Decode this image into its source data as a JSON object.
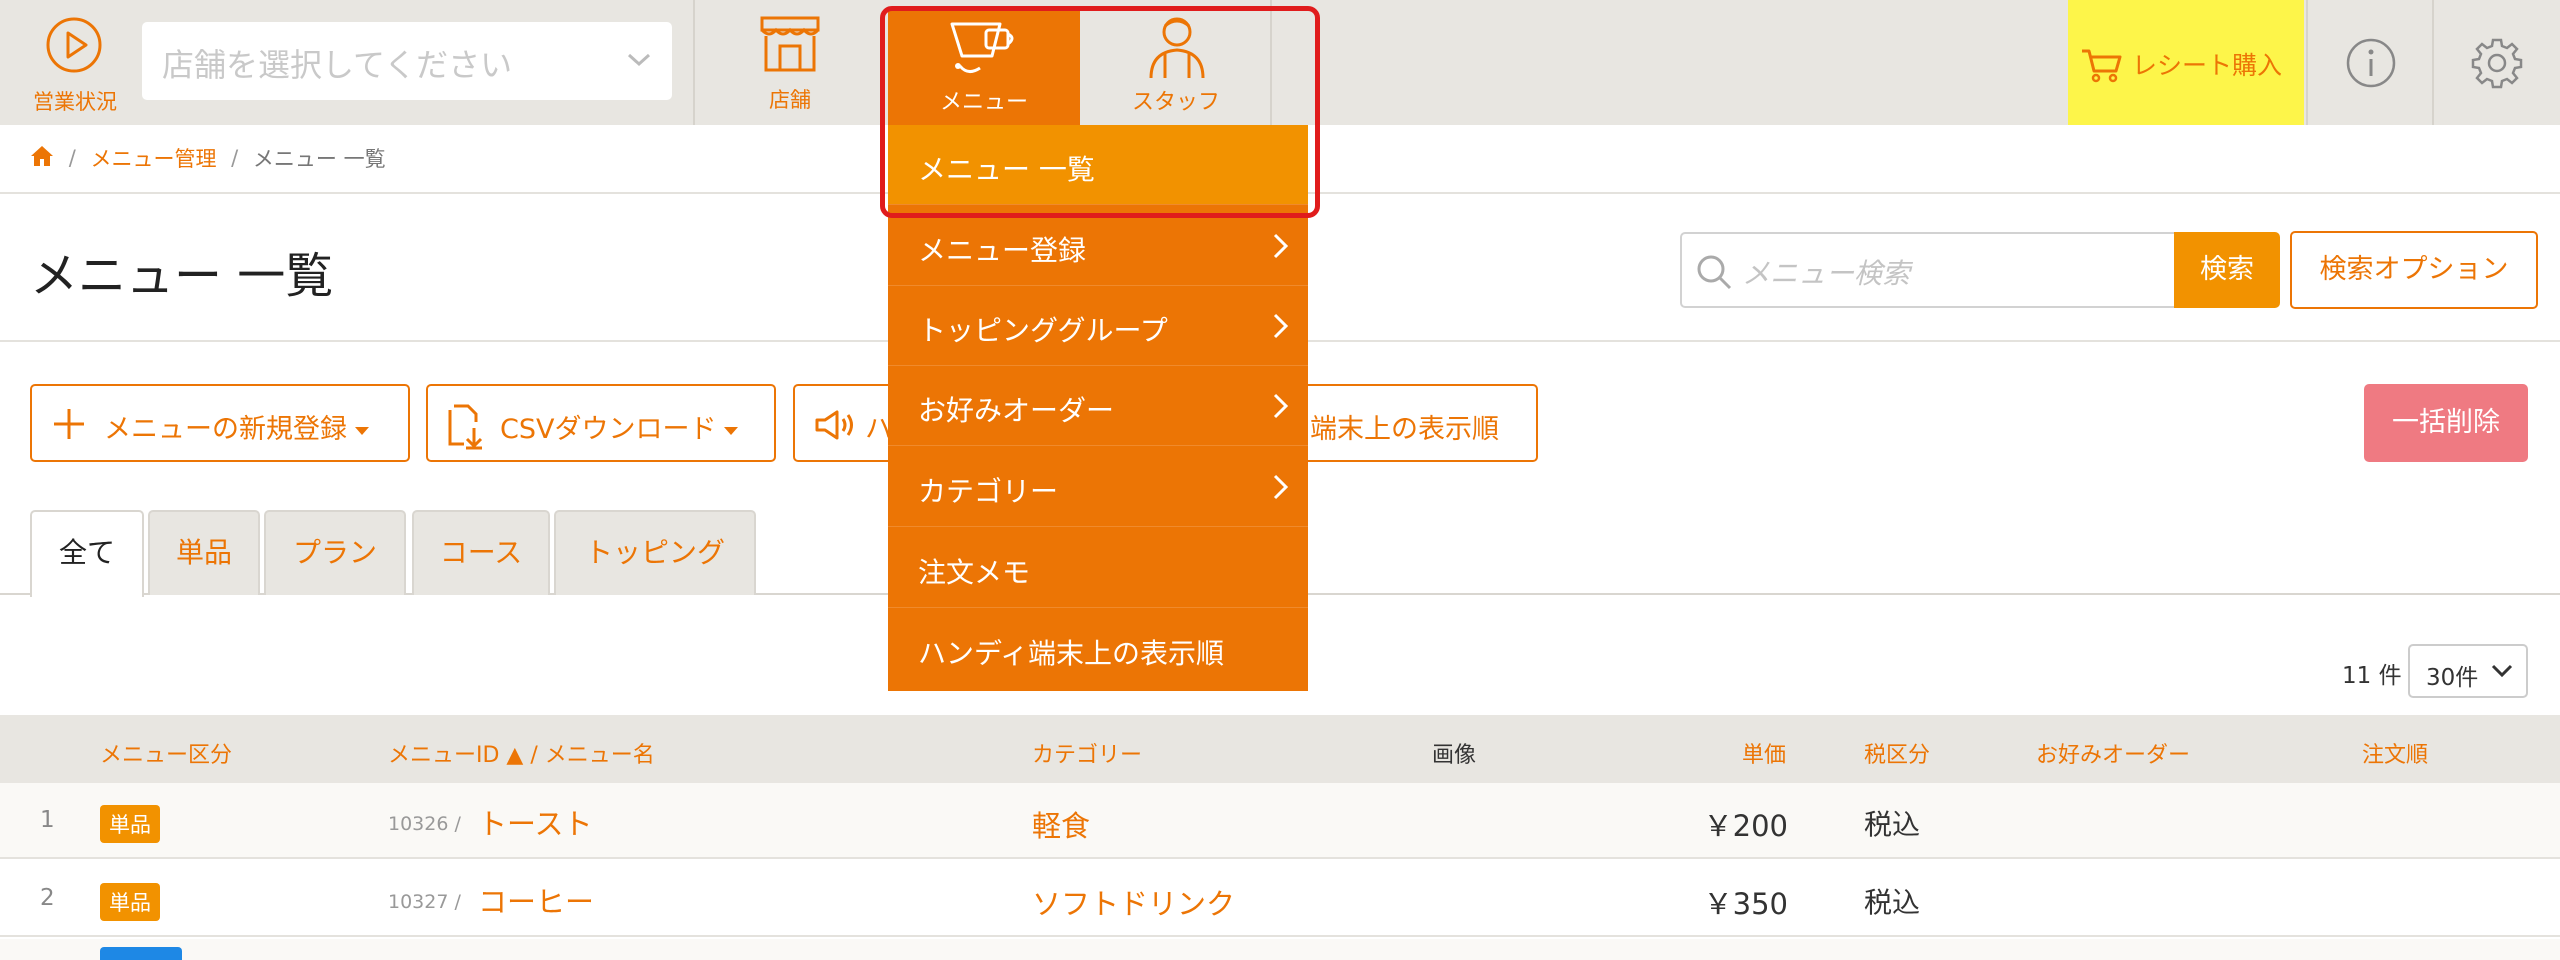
{
  "nav": {
    "status_label": "営業状況",
    "store_select_placeholder": "店舗を選択してください",
    "store_label": "店舗",
    "menu_label": "メニュー",
    "staff_label": "スタッフ",
    "receipt_label": "レシート購入"
  },
  "breadcrumb": {
    "items": [
      "メニュー管理",
      "メニュー 一覧"
    ]
  },
  "page": {
    "title": "メニュー 一覧"
  },
  "search": {
    "placeholder": "メニュー検索",
    "button": "検索",
    "options": "検索オプション"
  },
  "actions": {
    "new_menu": "メニューの新規登録",
    "csv": "CSVダウンロード",
    "handy_partial": "ハ",
    "display_order_partial": "端末上の表示順",
    "bulk_delete": "一括削除"
  },
  "tabs": [
    "全て",
    "単品",
    "プラン",
    "コース",
    "トッピング"
  ],
  "table": {
    "count": "11 件",
    "per_page": "30件",
    "headers": {
      "type": "メニュー区分",
      "id_name": "メニューID ▲ / メニュー名",
      "category": "カテゴリー",
      "image": "画像",
      "price": "単価",
      "tax": "税区分",
      "preference": "お好みオーダー",
      "order": "注文順"
    },
    "rows": [
      {
        "num": "1",
        "badge": "単品",
        "id": "10326 /",
        "name": "トースト",
        "category": "軽食",
        "price": "￥200",
        "tax": "税込"
      },
      {
        "num": "2",
        "badge": "単品",
        "id": "10327 /",
        "name": "コーヒー",
        "category": "ソフトドリンク",
        "price": "￥350",
        "tax": "税込"
      }
    ]
  },
  "dropdown": {
    "items": [
      {
        "label": "メニュー 一覧",
        "has_arrow": false,
        "active": true
      },
      {
        "label": "メニュー登録",
        "has_arrow": true
      },
      {
        "label": "トッピンググループ",
        "has_arrow": true
      },
      {
        "label": "お好みオーダー",
        "has_arrow": true
      },
      {
        "label": "カテゴリー",
        "has_arrow": true
      },
      {
        "label": "注文メモ",
        "has_arrow": false
      },
      {
        "label": "ハンディ端末上の表示順",
        "has_arrow": false
      }
    ]
  },
  "colors": {
    "accent": "#ec7505",
    "accent_light": "#f29200",
    "nav_bg": "#e8e6e1",
    "receipt_bg": "#fdf54a",
    "danger": "#ef7a82",
    "highlight_border": "#e01c1c"
  },
  "icons": [
    "play-circle-icon",
    "chevron-down-icon",
    "store-icon",
    "cup-icon",
    "person-icon",
    "cart-icon",
    "info-icon",
    "gear-icon",
    "home-icon",
    "search-icon",
    "plus-icon",
    "file-download-icon",
    "megaphone-icon",
    "chevron-right-icon"
  ]
}
